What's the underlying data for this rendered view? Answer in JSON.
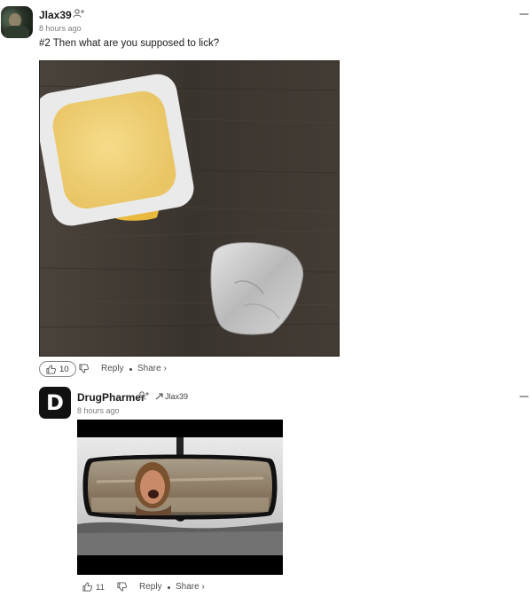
{
  "comment1": {
    "username": "Jlax39",
    "time": "8 hours ago",
    "text": "#2 Then what are you supposed to lick?",
    "likes": "10",
    "reply_label": "Reply",
    "share_label": "Share ›",
    "image_icon": "photo-image"
  },
  "comment2": {
    "avatar_letter": "D",
    "username": "DrugPharmer",
    "reply_to": "Jlax39",
    "time": "8 hours ago",
    "likes": "11",
    "reply_label": "Reply",
    "share_label": "Share ›",
    "image_icon": "gif-image"
  },
  "colors": {
    "text": "#1a1a1b",
    "muted": "#7c7c7c",
    "wood": "#3c3630"
  }
}
